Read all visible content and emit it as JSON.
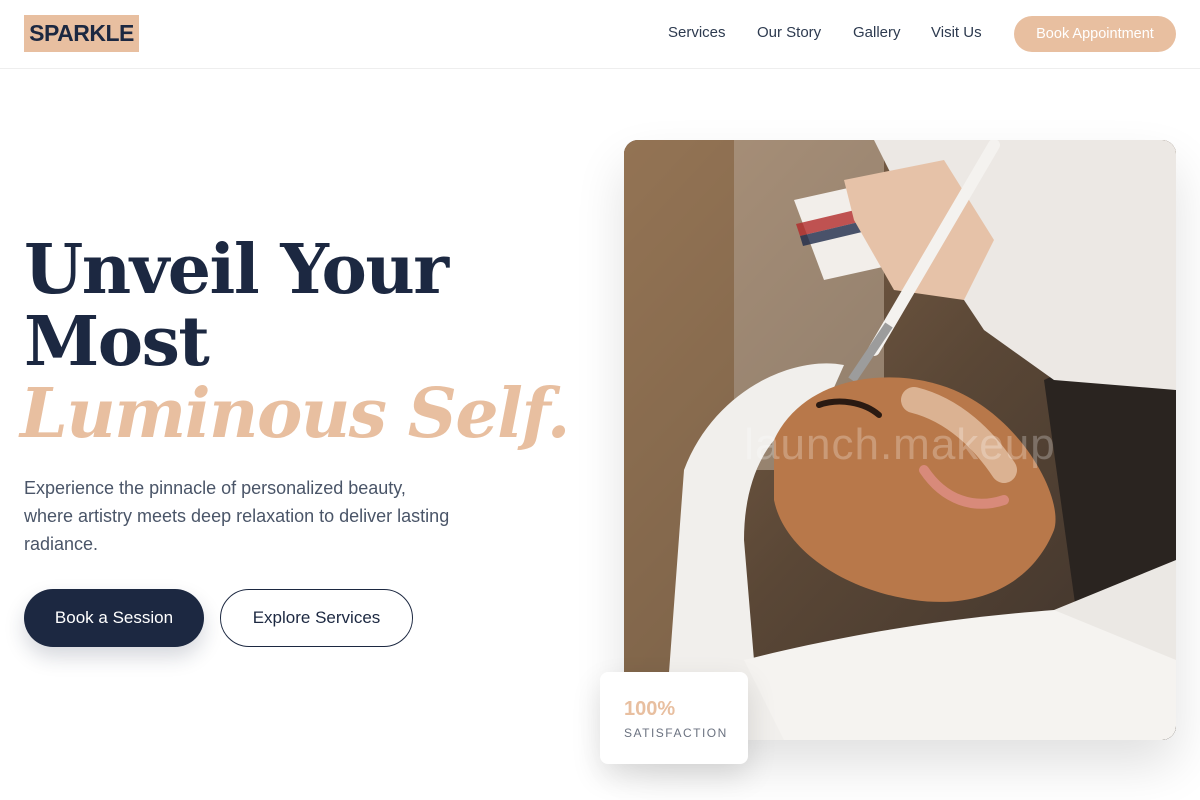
{
  "brand": {
    "logo_text": "SPARKLE",
    "accent_color": "#e8bfa0",
    "primary_color": "#1c2841"
  },
  "nav": {
    "items": [
      {
        "label": "Services"
      },
      {
        "label": "Our Story"
      },
      {
        "label": "Gallery"
      },
      {
        "label": "Visit Us"
      }
    ],
    "cta_label": "Book Appointment"
  },
  "hero": {
    "headline_line1": "Unveil Your",
    "headline_line2": "Most",
    "headline_accent": "Luminous Self.",
    "subtext": "Experience the pinnacle of personalized beauty, where artistry meets deep relaxation to deliver lasting radiance.",
    "primary_button": "Book a Session",
    "secondary_button": "Explore Services",
    "image_watermark": "launch.makeup",
    "stat": {
      "value": "100%",
      "label": "SATISFACTION"
    }
  }
}
